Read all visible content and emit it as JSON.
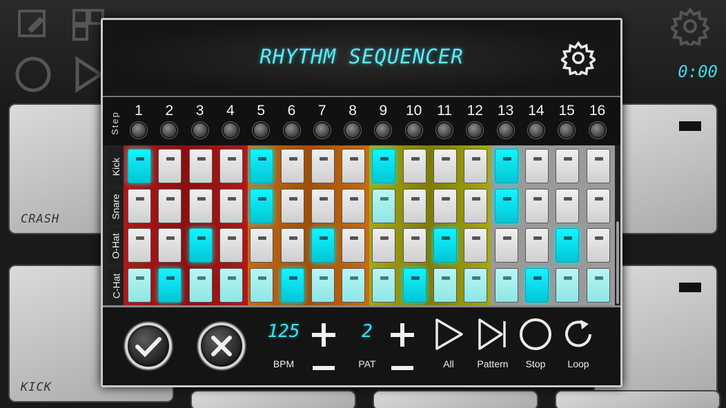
{
  "background": {
    "timer": "0:00",
    "pads": [
      {
        "label": "CRASH"
      },
      {
        "label": "KICK"
      }
    ]
  },
  "dialog": {
    "title": "RHYTHM SEQUENCER",
    "step_label": "Step",
    "steps": [
      "1",
      "2",
      "3",
      "4",
      "5",
      "6",
      "7",
      "8",
      "9",
      "10",
      "11",
      "12",
      "13",
      "14",
      "15",
      "16"
    ],
    "tracks": [
      {
        "name": "Kick",
        "pattern": [
          1,
          0,
          0,
          0,
          1,
          0,
          0,
          0,
          1,
          0,
          0,
          0,
          1,
          0,
          0,
          0
        ]
      },
      {
        "name": "Snare",
        "pattern": [
          0,
          0,
          0,
          0,
          1,
          0,
          0,
          0,
          0,
          0,
          0,
          0,
          1,
          0,
          0,
          0
        ]
      },
      {
        "name": "O-Hat",
        "pattern": [
          0,
          0,
          1,
          0,
          0,
          0,
          1,
          0,
          0,
          0,
          1,
          0,
          0,
          0,
          1,
          0
        ]
      },
      {
        "name": "C-Hat",
        "pattern": [
          0,
          1,
          0,
          0,
          0,
          1,
          0,
          0,
          0,
          1,
          0,
          0,
          0,
          1,
          0,
          0
        ]
      }
    ],
    "bpm": {
      "value": "125",
      "label": "BPM"
    },
    "pat": {
      "value": "2",
      "label": "PAT"
    },
    "transport": {
      "all_label": "All",
      "pattern_label": "Pattern",
      "stop_label": "Stop",
      "loop_label": "Loop"
    },
    "accent_color": "#00e6f5"
  }
}
